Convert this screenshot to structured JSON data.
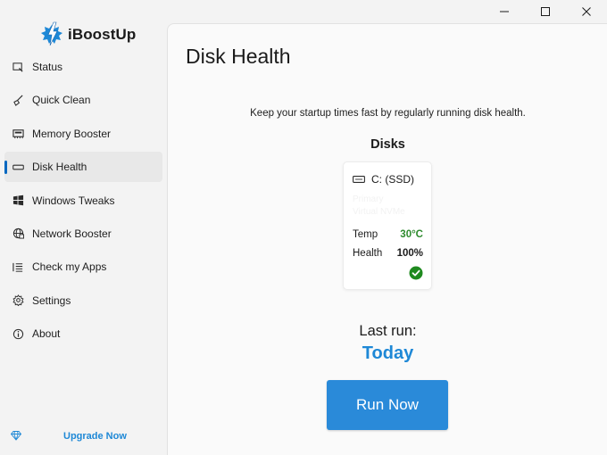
{
  "app": {
    "name": "iBoostUp",
    "brand_color": "#1e88d6"
  },
  "window_controls": {
    "minimize_icon": "minimize-icon",
    "maximize_icon": "maximize-icon",
    "close_icon": "close-icon"
  },
  "sidebar": {
    "active_index": 3,
    "items": [
      {
        "label": "Status",
        "icon": "status-icon"
      },
      {
        "label": "Quick Clean",
        "icon": "broom-icon"
      },
      {
        "label": "Memory Booster",
        "icon": "memory-icon"
      },
      {
        "label": "Disk Health",
        "icon": "disk-icon"
      },
      {
        "label": "Windows Tweaks",
        "icon": "windows-icon"
      },
      {
        "label": "Network Booster",
        "icon": "globe-icon"
      },
      {
        "label": "Check my Apps",
        "icon": "apps-list-icon"
      },
      {
        "label": "Settings",
        "icon": "gear-icon"
      },
      {
        "label": "About",
        "icon": "info-icon"
      }
    ],
    "upgrade": {
      "label": "Upgrade Now",
      "icon": "diamond-icon"
    }
  },
  "main": {
    "title": "Disk Health",
    "subtitle": "Keep your startup times fast by regularly running disk health.",
    "disks_heading": "Disks",
    "disks": [
      {
        "name": "C: (SSD)",
        "icon": "drive-icon",
        "detail_line1": "Primary",
        "detail_line2": "Virtual NVMe",
        "temp_label": "Temp",
        "temp_value": "30°C",
        "temp_color": "#2e8b2e",
        "health_label": "Health",
        "health_value": "100%",
        "status_icon": "check-circle-icon",
        "status_color": "#1f8a1f"
      }
    ],
    "last_run_label": "Last run:",
    "last_run_value": "Today",
    "run_button_label": "Run Now",
    "run_button_color": "#2a8ad9"
  }
}
